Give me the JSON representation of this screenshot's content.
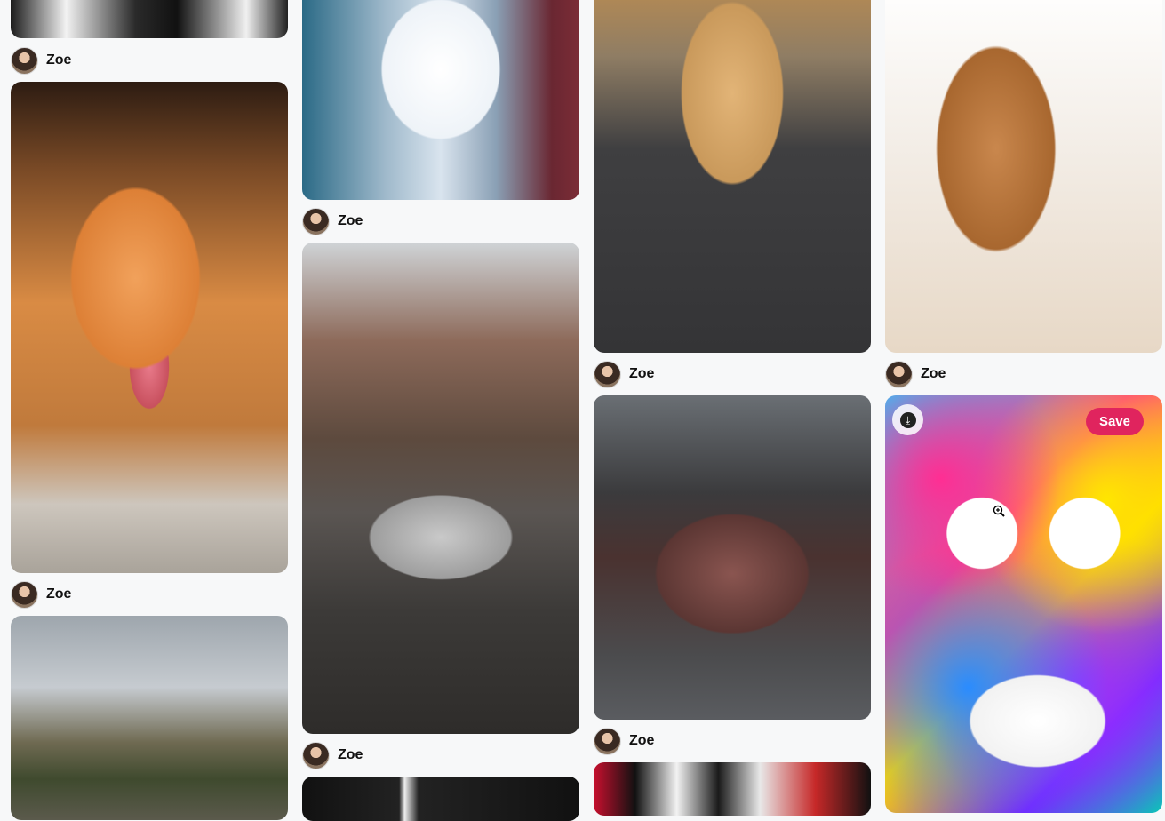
{
  "author_name": "Zoe",
  "save_label": "Save",
  "icons": {
    "download": "download-icon",
    "cursor": "zoom-in-cursor-icon"
  },
  "pins": [
    {
      "subject": "cat-ginger-kitten",
      "author": "Zoe"
    },
    {
      "subject": "white-kitten-snow",
      "author": "Zoe"
    },
    {
      "subject": "silver-sports-car-leaves",
      "author": "Zoe"
    },
    {
      "subject": "golden-puppy-leash",
      "author": "Zoe"
    },
    {
      "subject": "pink-suv",
      "author": "Zoe"
    },
    {
      "subject": "puppy-headphones",
      "author": "Zoe"
    },
    {
      "subject": "graffiti-face"
    }
  ],
  "colors": {
    "save_button": "#e0245e",
    "background": "#f7f8f9"
  }
}
